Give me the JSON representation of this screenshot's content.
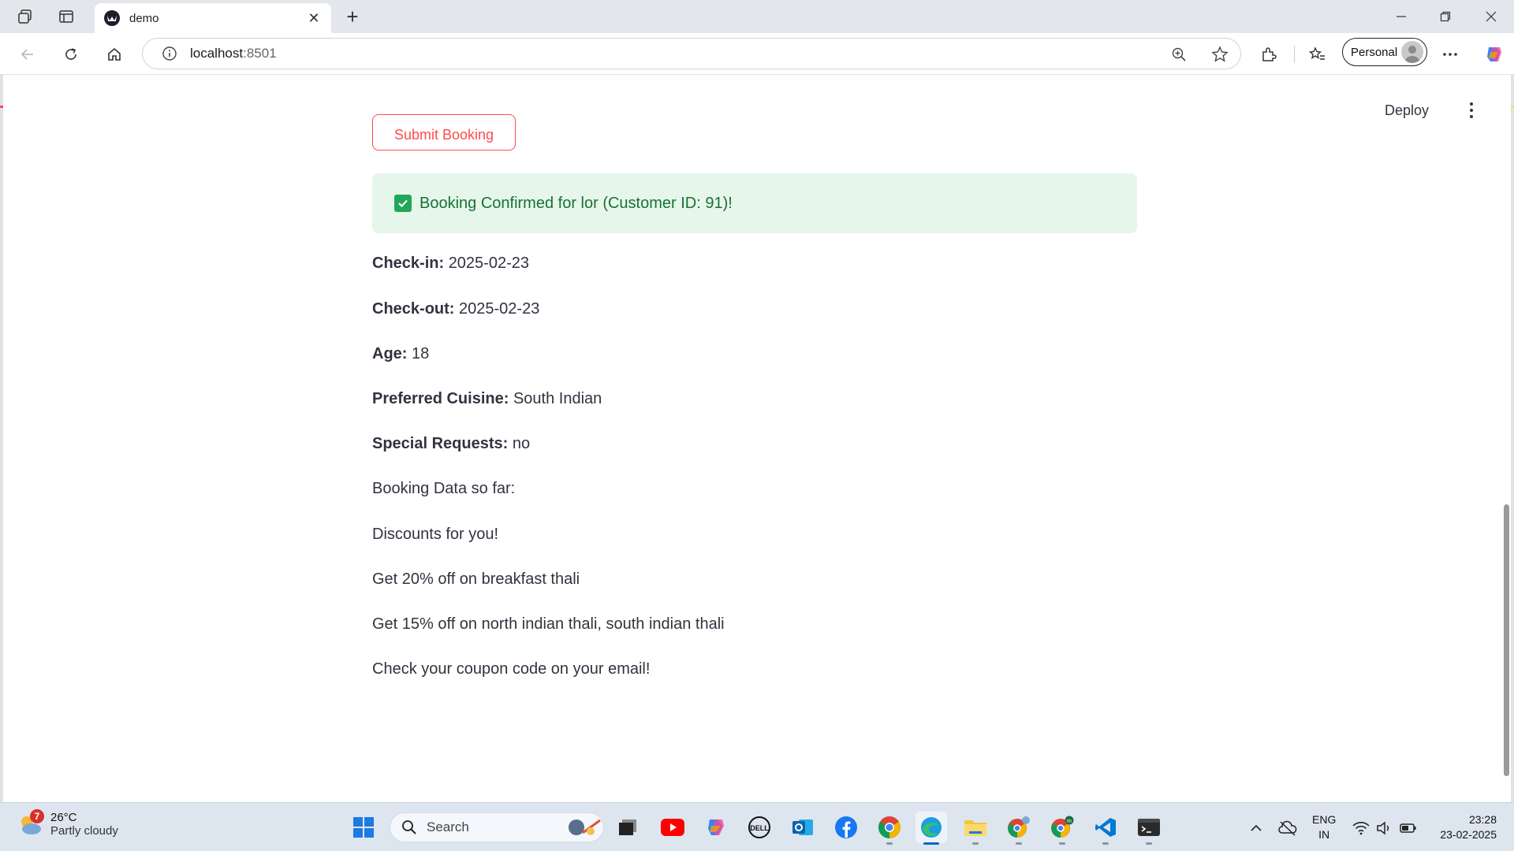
{
  "browser": {
    "tab_title": "demo",
    "url_host": "localhost",
    "url_port": ":8501",
    "profile_label": "Personal"
  },
  "app": {
    "deploy_label": "Deploy",
    "submit_button_label": "Submit Booking",
    "success_message": "Booking Confirmed for lor (Customer ID: 91)!",
    "details": [
      {
        "label": "Check-in:",
        "value": "2025-02-23"
      },
      {
        "label": "Check-out:",
        "value": "2025-02-23"
      },
      {
        "label": "Age:",
        "value": "18"
      },
      {
        "label": "Preferred Cuisine:",
        "value": "South Indian"
      },
      {
        "label": "Special Requests:",
        "value": "no"
      }
    ],
    "lines": [
      "Booking Data so far:",
      "Discounts for you!",
      "Get 20% off on breakfast thali",
      "Get 15% off on north indian thali, south indian thali",
      "Check your coupon code on your email!"
    ],
    "colors": {
      "accent": "#ff4b4b",
      "success_bg": "#e6f6ea",
      "success_text": "#177233",
      "text": "#31333f"
    }
  },
  "taskbar": {
    "weather_badge": "7",
    "weather_temp": "26°C",
    "weather_desc": "Partly cloudy",
    "search_label": "Search",
    "lang_top": "ENG",
    "lang_bottom": "IN",
    "time": "23:28",
    "date": "23-02-2025",
    "apps": [
      "windows-start-icon",
      "task-view-icon",
      "youtube-icon",
      "copilot-icon",
      "dell-icon",
      "outlook-icon",
      "facebook-icon",
      "chrome-icon",
      "edge-icon",
      "file-explorer-icon",
      "chrome-profile-icon",
      "chrome-profile-m-icon",
      "vscode-icon",
      "terminal-icon"
    ]
  }
}
